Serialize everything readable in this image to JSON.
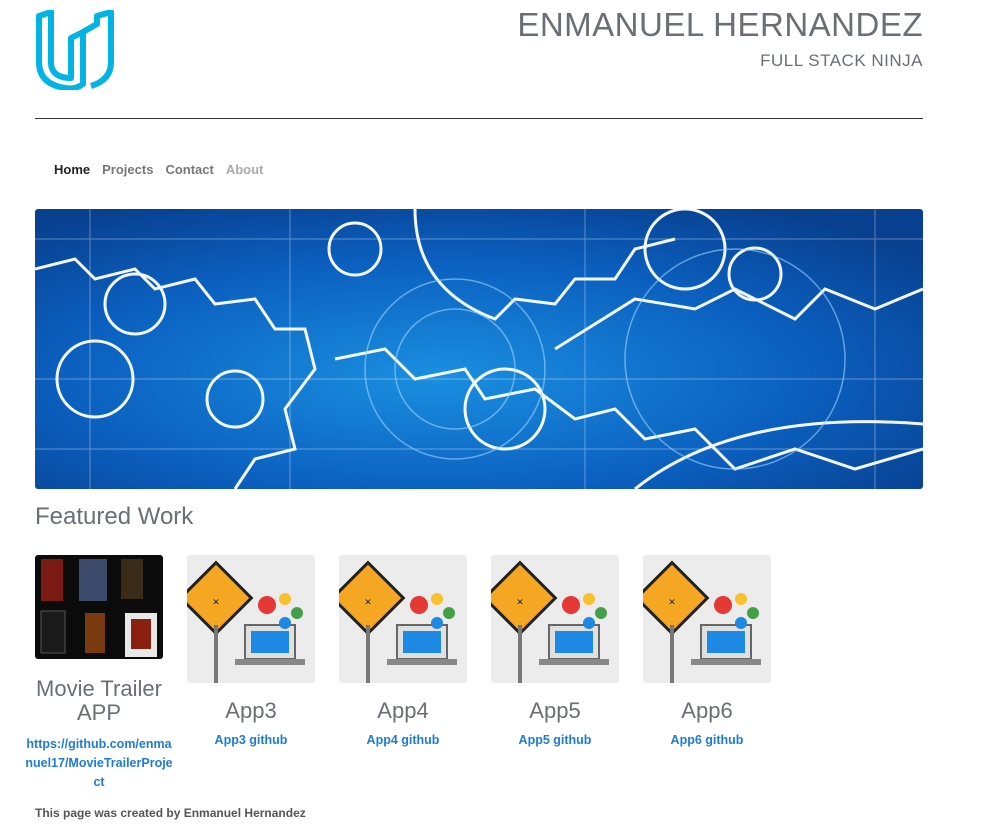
{
  "header": {
    "name": "ENMANUEL HERNANDEZ",
    "role": "FULL STACK NINJA"
  },
  "nav": {
    "items": [
      {
        "label": "Home"
      },
      {
        "label": "Projects"
      },
      {
        "label": "Contact"
      },
      {
        "label": "About"
      }
    ]
  },
  "featured": {
    "title": "Featured Work",
    "projects": [
      {
        "title": "Movie Trailer APP",
        "link": "https://github.com/enmanuel17/MovieTrailerProject"
      },
      {
        "title": "App3",
        "link": "App3 github"
      },
      {
        "title": "App4",
        "link": "App4 github"
      },
      {
        "title": "App5",
        "link": "App5 github"
      },
      {
        "title": "App6",
        "link": "App6 github"
      }
    ]
  },
  "footer": {
    "text": "This page was created by Enmanuel Hernandez"
  },
  "colors": {
    "logo": "#02b3e4",
    "link": "#1f7bd8",
    "hero": "#0a4fa6"
  }
}
